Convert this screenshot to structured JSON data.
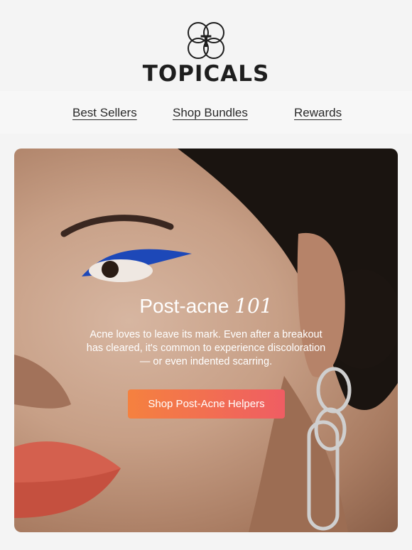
{
  "brand": {
    "logo_letter": "T",
    "name": "TOPICALS"
  },
  "nav": {
    "items": [
      "Best Sellers",
      "Shop Bundles",
      "Rewards"
    ]
  },
  "hero": {
    "title_text": "Post-acne",
    "title_number": "101",
    "body": "Acne loves to leave its mark. Even after a breakout has cleared, it's common to experience discoloration — or even indented scarring.",
    "cta_label": "Shop Post-Acne Helpers"
  },
  "colors": {
    "page_bg": "#f4f4f4",
    "cta_start": "#f5813f",
    "cta_end": "#ef5d63",
    "text": "#1f1f1f"
  }
}
